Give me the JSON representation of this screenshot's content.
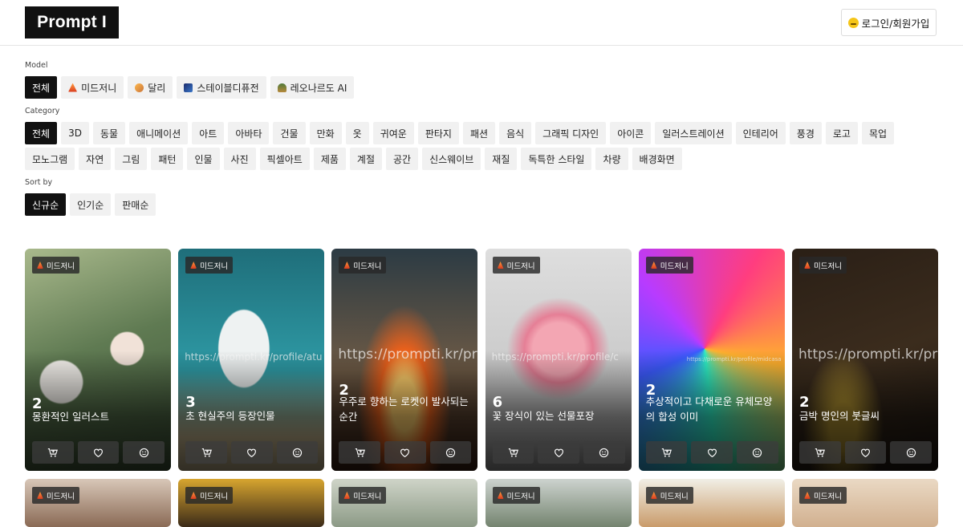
{
  "header": {
    "logo": "Prompt I",
    "login_label": "로그인/회원가입"
  },
  "filters": {
    "model_label": "Model",
    "models": [
      {
        "label": "전체",
        "icon": "",
        "active": true
      },
      {
        "label": "미드저니",
        "icon": "midjourney-icon"
      },
      {
        "label": "달리",
        "icon": "dalle-icon"
      },
      {
        "label": "스테이블디퓨전",
        "icon": "stable-diffusion-icon"
      },
      {
        "label": "레오나르도 AI",
        "icon": "leonardo-icon"
      }
    ],
    "category_label": "Category",
    "categories": [
      "전체",
      "3D",
      "동물",
      "애니메이션",
      "아트",
      "아바타",
      "건물",
      "만화",
      "옷",
      "귀여운",
      "판타지",
      "패션",
      "음식",
      "그래픽 디자인",
      "아이콘",
      "일러스트레이션",
      "인테리어",
      "풍경",
      "로고",
      "목업",
      "모노그램",
      "자연",
      "그림",
      "패턴",
      "인물",
      "사진",
      "픽셀아트",
      "제품",
      "계절",
      "공간",
      "신스웨이브",
      "재질",
      "독특한 스타일",
      "차량",
      "배경화면"
    ],
    "sort_label": "Sort by",
    "sorts": [
      "신규순",
      "인기순",
      "판매순"
    ]
  },
  "cards": [
    {
      "badge": "미드저니",
      "count": "2",
      "title": "몽환적인 일러스트",
      "watermark": ""
    },
    {
      "badge": "미드저니",
      "count": "3",
      "title": "초 현실주의 등장인물",
      "watermark": "https://prompti.kr/profile/atu"
    },
    {
      "badge": "미드저니",
      "count": "2",
      "title": "우주로 향하는 로켓이 발사되는 순간",
      "watermark": "https://prompti.kr/pr"
    },
    {
      "badge": "미드저니",
      "count": "6",
      "title": "꽃 장식이 있는 선물포장",
      "watermark": "https://prompti.kr/profile/c"
    },
    {
      "badge": "미드저니",
      "count": "2",
      "title": "추상적이고 다채로운 유체모양의 합성 이미",
      "watermark": "https://prompti.kr/profile/midcasa"
    },
    {
      "badge": "미드저니",
      "count": "2",
      "title": "금박 명인의 붓글씨",
      "watermark": "https://prompti.kr/pr"
    }
  ],
  "cards_row2": [
    {
      "badge": "미드저니"
    },
    {
      "badge": "미드저니"
    },
    {
      "badge": "미드저니"
    },
    {
      "badge": "미드저니"
    },
    {
      "badge": "미드저니"
    },
    {
      "badge": "미드저니"
    }
  ],
  "colors": {
    "primary": "#111111",
    "chip_bg": "#f1f1f1"
  }
}
